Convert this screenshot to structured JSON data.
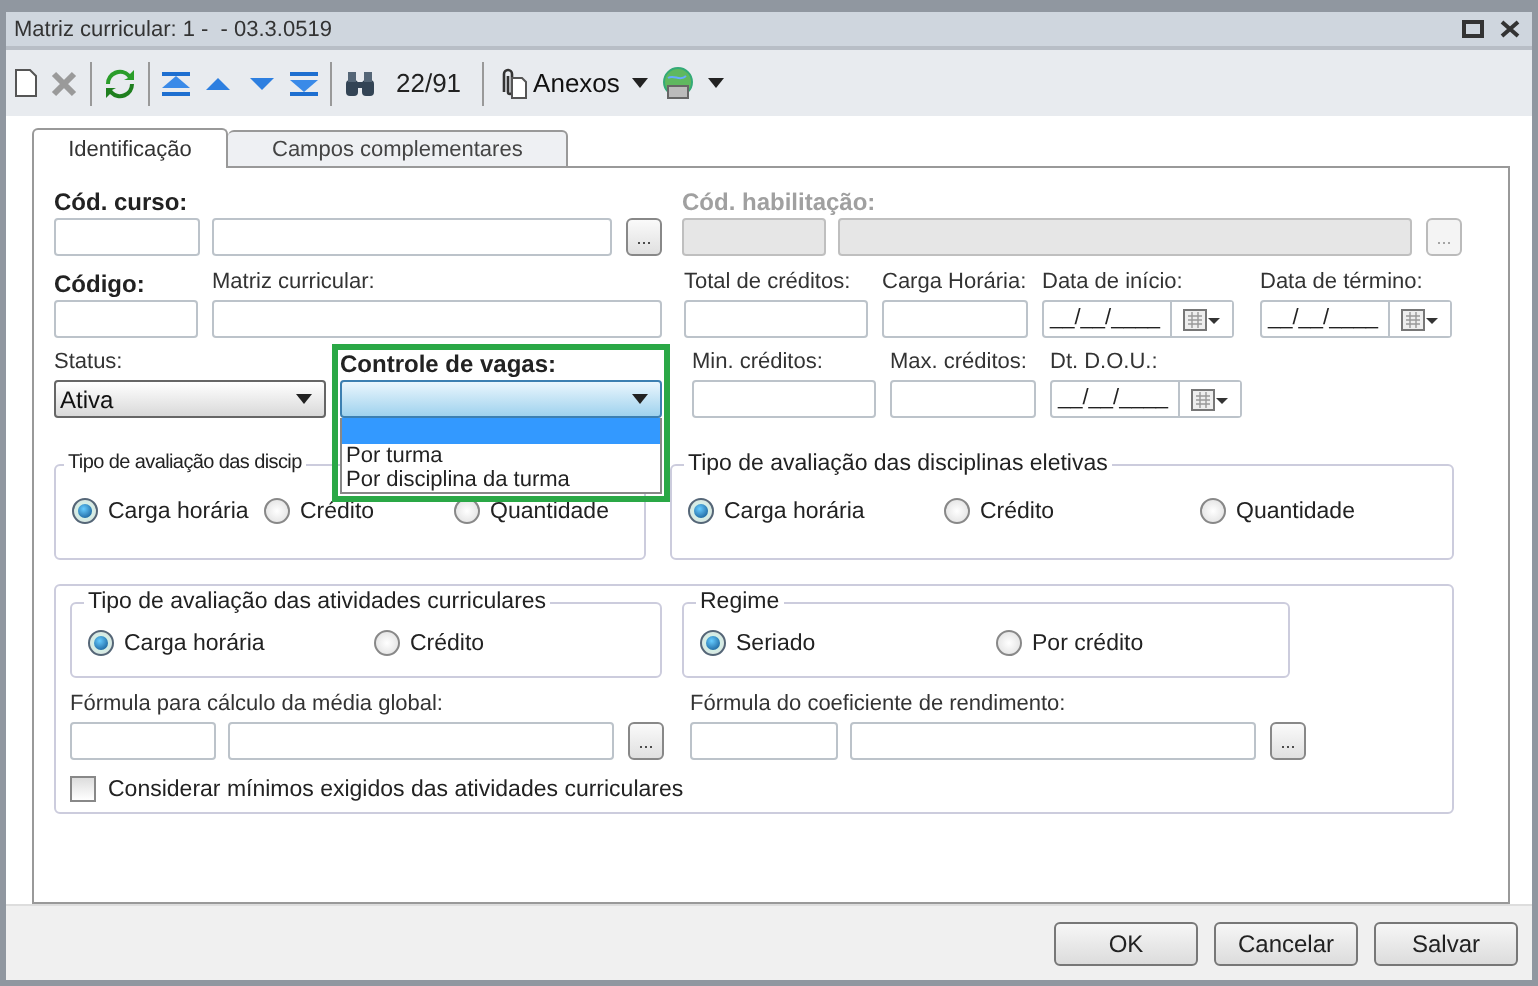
{
  "window": {
    "title": "Matriz curricular: 1 -  - 03.3.0519"
  },
  "toolbar": {
    "record_counter": "22/91",
    "attachments_label": "Anexos"
  },
  "tabs": [
    {
      "label": "Identificação",
      "selected": true
    },
    {
      "label": "Campos complementares",
      "selected": false
    }
  ],
  "course": {
    "label": "Cód. curso:",
    "required": true,
    "disabled": false,
    "lookup_button": "..."
  },
  "qualification": {
    "label": "Cód. habilitação:",
    "required": true,
    "disabled": true,
    "lookup_button": "..."
  },
  "row2": [
    {
      "kind": "text",
      "label": "Código:",
      "required": true
    },
    {
      "kind": "text",
      "label": "Matriz curricular:",
      "required": false
    },
    {
      "kind": "text",
      "label": "Total de créditos:",
      "required": false
    },
    {
      "kind": "text",
      "label": "Carga Horária:",
      "required": false
    },
    {
      "kind": "date",
      "label": "Data de início:",
      "required": false,
      "value": "__/__/____"
    },
    {
      "kind": "date",
      "label": "Data de término:",
      "required": false,
      "value": "__/__/____"
    }
  ],
  "row3": [
    {
      "kind": "select",
      "label": "Status:",
      "required": false,
      "value": "Ativa"
    },
    {
      "kind": "dropdown",
      "label": "Controle de vagas:",
      "required": true,
      "highlighted": true,
      "blank_highlighted": true,
      "options": [
        {
          "label": "Por turma",
          "selected": false
        },
        {
          "label": "Por disciplina da turma",
          "selected": false
        }
      ]
    },
    {
      "kind": "text",
      "label": "Min. créditos:",
      "required": false
    },
    {
      "kind": "text",
      "label": "Max. créditos:",
      "required": false
    },
    {
      "kind": "date",
      "label": "Dt. D.O.U.:",
      "required": false,
      "value": "__/__/____"
    }
  ],
  "evaluation_groups": [
    {
      "title": "Tipo de avaliação das discip",
      "options": [
        {
          "label": "Carga horária",
          "selected": true
        },
        {
          "label": "Crédito",
          "selected": false
        },
        {
          "label": "Quantidade",
          "selected": false
        }
      ]
    },
    {
      "title": "Tipo de avaliação das disciplinas eletivas",
      "options": [
        {
          "label": "Carga horária",
          "selected": true
        },
        {
          "label": "Crédito",
          "selected": false
        },
        {
          "label": "Quantidade",
          "selected": false
        }
      ]
    }
  ],
  "curricular_activities": {
    "groups": [
      {
        "title": "Tipo de avaliação das atividades curriculares",
        "options": [
          {
            "label": "Carga horária",
            "selected": true
          },
          {
            "label": "Crédito",
            "selected": false
          }
        ]
      },
      {
        "title": "Regime",
        "options": [
          {
            "label": "Seriado",
            "selected": true
          },
          {
            "label": "Por crédito",
            "selected": false
          }
        ]
      }
    ],
    "formulas": [
      {
        "label": "Fórmula para cálculo da média global:",
        "lookup_button": "..."
      },
      {
        "label": "Fórmula do coeficiente de rendimento:",
        "lookup_button": "..."
      }
    ],
    "checkbox": {
      "label": "Considerar mínimos exigidos das atividades curriculares",
      "checked": false
    }
  },
  "buttons": [
    "OK",
    "Cancelar",
    "Salvar"
  ]
}
